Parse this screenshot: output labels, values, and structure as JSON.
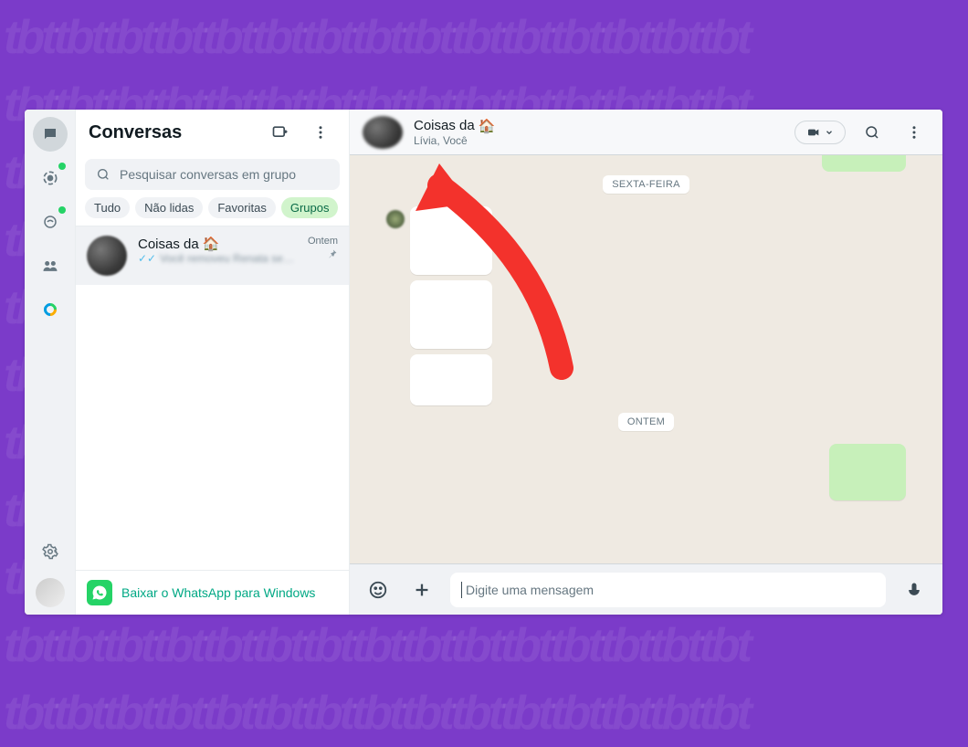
{
  "watermark": "tbt",
  "sidebar": {
    "title": "Conversas",
    "search_placeholder": "Pesquisar conversas em grupo",
    "filters": [
      "Tudo",
      "Não lidas",
      "Favoritas",
      "Grupos"
    ],
    "active_filter_index": 3,
    "chats": [
      {
        "name": "Coisas da",
        "emoji": "🏠",
        "time": "Ontem",
        "preview": "Você removeu Renata segunda",
        "pinned": true
      }
    ],
    "download_label": "Baixar o WhatsApp para Windows"
  },
  "chat": {
    "title": "Coisas da",
    "title_emoji": "🏠",
    "subtitle": "Lívia, Você",
    "day_labels": [
      "SEXTA-FEIRA",
      "ONTEM"
    ],
    "input_placeholder": "Digite uma mensagem"
  }
}
